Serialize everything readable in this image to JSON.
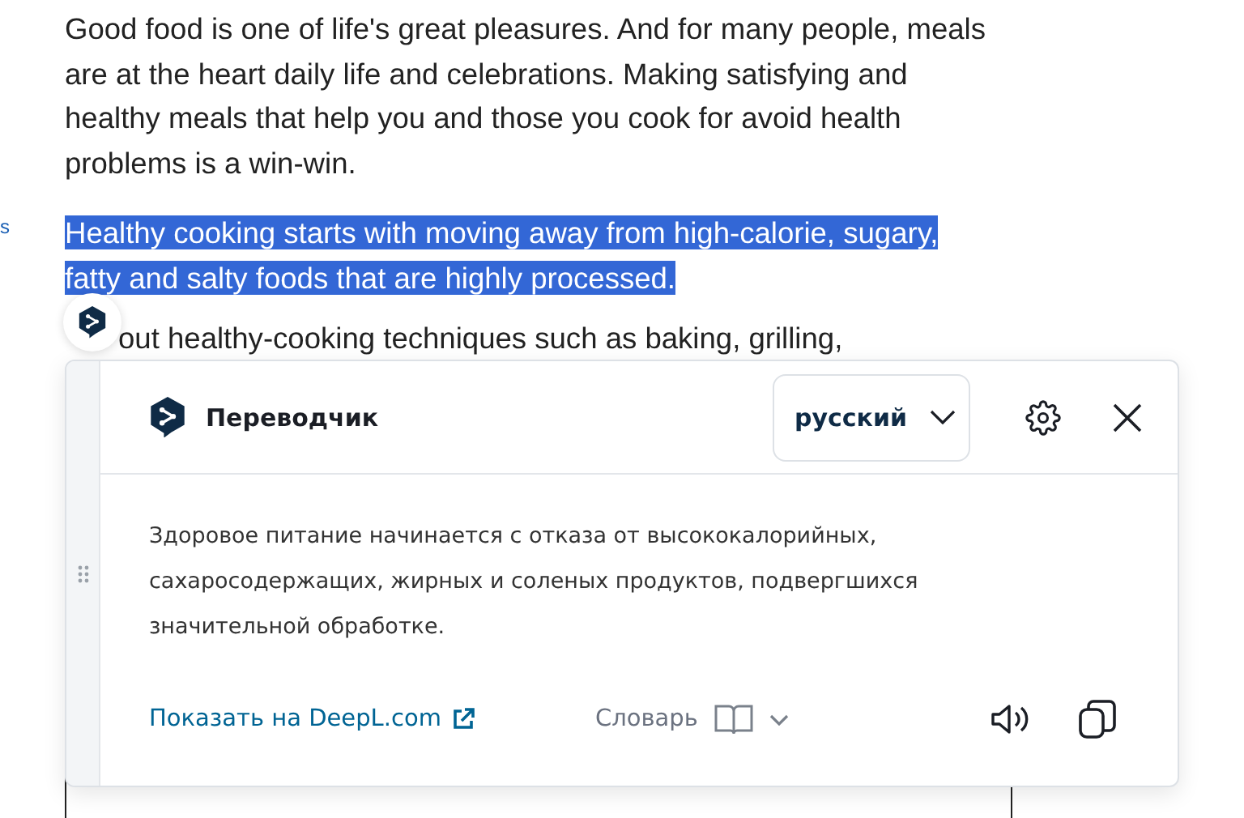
{
  "margin_link": {
    "text": "s"
  },
  "article": {
    "paragraphs": [
      {
        "text": "Good food is one of life's great pleasures. And for many people, meals are at the heart daily life and celebrations. Making satisfying and healthy meals that help you and those you cook for avoid health problems is a win-win.",
        "selected": false
      },
      {
        "text": "Healthy cooking starts with moving away from high-calorie, sugary, fatty and salty foods that are highly processed.",
        "selected": true
      },
      {
        "text": "out healthy-cooking techniques such as baking, grilling,",
        "selected": false
      }
    ]
  },
  "popup": {
    "title": "Переводчик",
    "language": "русский",
    "translation": "Здоровое питание начинается с отказа от высококалорийных, сахаросодержащих, жирных и соленых продуктов, подвергшихся значительной обработке.",
    "open_link": "Показать на DeepL.com",
    "dictionary": "Словарь"
  }
}
